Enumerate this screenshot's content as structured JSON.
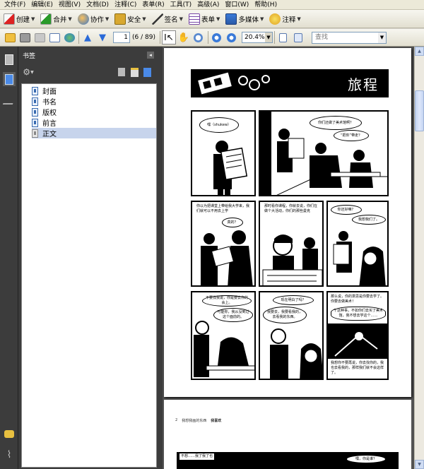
{
  "menu": [
    "文件(F)",
    "编辑(E)",
    "视图(V)",
    "文档(D)",
    "注释(C)",
    "表单(R)",
    "工具(T)",
    "高级(A)",
    "窗口(W)",
    "帮助(H)"
  ],
  "toolbar": {
    "create": "创建",
    "combine": "合并",
    "collaborate": "协作",
    "secure": "安全",
    "sign": "签名",
    "forms": "表单",
    "multimedia": "多媒体",
    "comment": "注释"
  },
  "nav": {
    "page_number": "1",
    "page_count": "(6 / 89)",
    "zoom": "20.4%",
    "find_placeholder": "查找"
  },
  "bookmarks_panel": {
    "title": "书签",
    "items": [
      {
        "label": "封面",
        "selected": false
      },
      {
        "label": "书名",
        "selected": false
      },
      {
        "label": "版权",
        "selected": false
      },
      {
        "label": "前言",
        "selected": false
      },
      {
        "label": "正文",
        "selected": true
      }
    ]
  },
  "document": {
    "page1_title": "旅程",
    "panels": {
      "p1_bubble": "嘿（shukew）",
      "p2_bubble1": "你们还做了美术馆啊？",
      "p2_bubble2": "“把你”带走？",
      "p3_caption": "你以为把课堂上带给我大学来，我们就可以不用去上学",
      "p3_bubble": "真的？",
      "p4_caption": "那时看你课程，你就去说，你们在做个大活动，你们的那些曼克",
      "p5_bubble1": "你还好嘛？",
      "p5_bubble2": "我想我们了。",
      "p6_bubble1": "不要找我说，你是要去你的会上。",
      "p6_bubble2": "可能你，我从没到过这个面前的。",
      "p7_bubble1": "现在明白了吗？",
      "p7_bubble2": "我要去，我要看我的，去看我的东西。",
      "p8_caption1": "那么说，你的意思是你要去学了。你要去做美术！",
      "p8_bubble": "干这种事，不如你们去买了美术馆，我不想去学这个……",
      "p8_caption2": "我想你不要再说，你去找你的，我也去看我的，那样我们就不会这样了。"
    },
    "page2_header_num": "2",
    "page2_header_text": "我想我画的东西",
    "page2_header_bold": "我喜欢",
    "page2_caption": "不想……我了我了也",
    "page2_bubble": "嘿，你是谁？"
  },
  "colors": {
    "chrome": "#ece9d8",
    "panel_bg": "#3c3c3c",
    "doc_bg": "#525252",
    "selection": "#c7d4ec"
  }
}
